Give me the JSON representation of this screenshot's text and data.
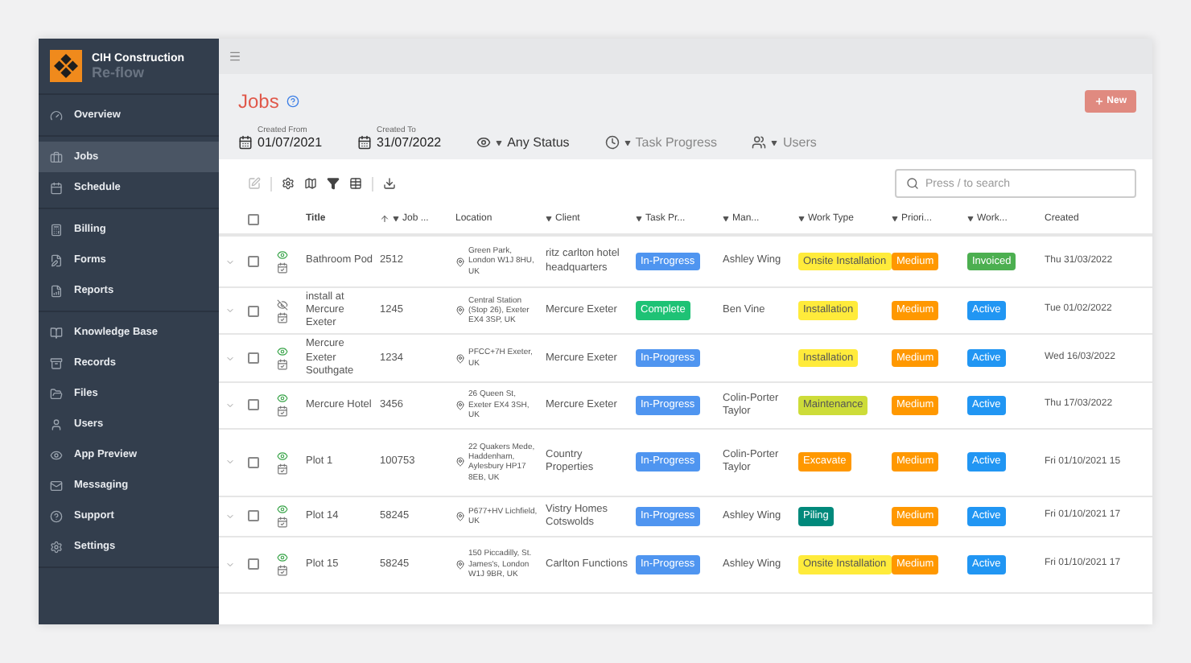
{
  "brand": {
    "name": "CIH Construction",
    "product": "Re-flow"
  },
  "sidebar": {
    "groups": [
      [
        {
          "label": "Overview",
          "selected": false
        }
      ],
      [
        {
          "label": "Jobs",
          "selected": true
        },
        {
          "label": "Schedule",
          "selected": false
        }
      ],
      [
        {
          "label": "Billing",
          "selected": false
        },
        {
          "label": "Forms",
          "selected": false
        },
        {
          "label": "Reports",
          "selected": false
        }
      ],
      [
        {
          "label": "Knowledge Base",
          "selected": false
        },
        {
          "label": "Records",
          "selected": false
        },
        {
          "label": "Files",
          "selected": false
        },
        {
          "label": "Users",
          "selected": false
        },
        {
          "label": "App Preview",
          "selected": false
        },
        {
          "label": "Messaging",
          "selected": false
        },
        {
          "label": "Support",
          "selected": false
        },
        {
          "label": "Settings",
          "selected": false
        }
      ]
    ]
  },
  "page": {
    "title": "Jobs",
    "new_button": "New"
  },
  "filters": {
    "created_from": {
      "label": "Created From",
      "value": "01/07/2021"
    },
    "created_to": {
      "label": "Created To",
      "value": "31/07/2022"
    },
    "status": "Any Status",
    "task_progress": "Task Progress",
    "users": "Users"
  },
  "search": {
    "placeholder": "Press / to search"
  },
  "table": {
    "all_checked": false,
    "columns": [
      {
        "label": "Title",
        "filter": false,
        "sorted": false
      },
      {
        "label": "Job ...",
        "filter": true,
        "sorted": true
      },
      {
        "label": "Location",
        "filter": false,
        "sorted": false
      },
      {
        "label": "Client",
        "filter": true,
        "sorted": false
      },
      {
        "label": "Task Pr...",
        "filter": true,
        "sorted": false
      },
      {
        "label": "Man...",
        "filter": true,
        "sorted": false
      },
      {
        "label": "Work Type",
        "filter": true,
        "sorted": false
      },
      {
        "label": "Priori...",
        "filter": true,
        "sorted": false
      },
      {
        "label": "Work...",
        "filter": true,
        "sorted": false
      },
      {
        "label": "Created",
        "filter": false,
        "sorted": false
      }
    ],
    "rows": [
      {
        "checked": false,
        "visible": true,
        "title": "Bathroom Pod",
        "job": "2512",
        "location": "Green Park, London W1J 8HU, UK",
        "client": "ritz carlton hotel headquarters",
        "task": {
          "label": "In-Progress",
          "color": "#4f95f0"
        },
        "manager": "Ashley Wing",
        "work_type": {
          "label": "Onsite Installation",
          "color": "#ffeb3b"
        },
        "priority": {
          "label": "Medium",
          "color": "#ff9800"
        },
        "status": {
          "label": "Invoiced",
          "color": "#4caf50"
        },
        "created": "Thu 31/03/2022"
      },
      {
        "checked": false,
        "visible": false,
        "title": "install at Mercure Exeter",
        "job": "1245",
        "location": "Central Station (Stop 26), Exeter EX4 3SP, UK",
        "client": "Mercure Exeter",
        "task": {
          "label": "Complete",
          "color": "#1ec275"
        },
        "manager": "Ben Vine",
        "work_type": {
          "label": "Installation",
          "color": "#ffeb3b"
        },
        "priority": {
          "label": "Medium",
          "color": "#ff9800"
        },
        "status": {
          "label": "Active",
          "color": "#2196f3"
        },
        "created": "Tue 01/02/2022"
      },
      {
        "checked": false,
        "visible": true,
        "title": "Mercure Exeter Southgate",
        "job": "1234",
        "location": "PFCC+7H Exeter, UK",
        "client": "Mercure Exeter",
        "task": {
          "label": "In-Progress",
          "color": "#4f95f0"
        },
        "manager": "",
        "work_type": {
          "label": "Installation",
          "color": "#ffeb3b"
        },
        "priority": {
          "label": "Medium",
          "color": "#ff9800"
        },
        "status": {
          "label": "Active",
          "color": "#2196f3"
        },
        "created": "Wed 16/03/2022"
      },
      {
        "checked": false,
        "visible": true,
        "title": "Mercure Hotel",
        "job": "3456",
        "location": "26 Queen St, Exeter EX4 3SH, UK",
        "client": "Mercure Exeter",
        "task": {
          "label": "In-Progress",
          "color": "#4f95f0"
        },
        "manager": "Colin-Porter Taylor",
        "work_type": {
          "label": "Maintenance",
          "color": "#cddc39"
        },
        "priority": {
          "label": "Medium",
          "color": "#ff9800"
        },
        "status": {
          "label": "Active",
          "color": "#2196f3"
        },
        "created": "Thu 17/03/2022"
      },
      {
        "checked": false,
        "visible": true,
        "title": "Plot 1",
        "job": "100753",
        "location": "22 Quakers Mede, Haddenham, Aylesbury HP17 8EB, UK",
        "client": "Country Properties",
        "task": {
          "label": "In-Progress",
          "color": "#4f95f0"
        },
        "manager": "Colin-Porter Taylor",
        "work_type": {
          "label": "Excavate",
          "color": "#ff9800"
        },
        "priority": {
          "label": "Medium",
          "color": "#ff9800"
        },
        "status": {
          "label": "Active",
          "color": "#2196f3"
        },
        "created": "Fri 01/10/2021 15"
      },
      {
        "checked": false,
        "visible": true,
        "title": "Plot 14",
        "job": "58245",
        "location": "P677+HV Lichfield, UK",
        "client": "Vistry Homes Cotswolds",
        "task": {
          "label": "In-Progress",
          "color": "#4f95f0"
        },
        "manager": "Ashley Wing",
        "work_type": {
          "label": "Piling",
          "color": "#00897b"
        },
        "priority": {
          "label": "Medium",
          "color": "#ff9800"
        },
        "status": {
          "label": "Active",
          "color": "#2196f3"
        },
        "created": "Fri 01/10/2021 17"
      },
      {
        "checked": false,
        "visible": true,
        "title": "Plot 15",
        "job": "58245",
        "location": "150 Piccadilly, St. James's, London W1J 9BR, UK",
        "client": "Carlton Functions",
        "task": {
          "label": "In-Progress",
          "color": "#4f95f0"
        },
        "manager": "Ashley Wing",
        "work_type": {
          "label": "Onsite Installation",
          "color": "#ffeb3b"
        },
        "priority": {
          "label": "Medium",
          "color": "#ff9800"
        },
        "status": {
          "label": "Active",
          "color": "#2196f3"
        },
        "created": "Fri 01/10/2021 17"
      }
    ]
  }
}
